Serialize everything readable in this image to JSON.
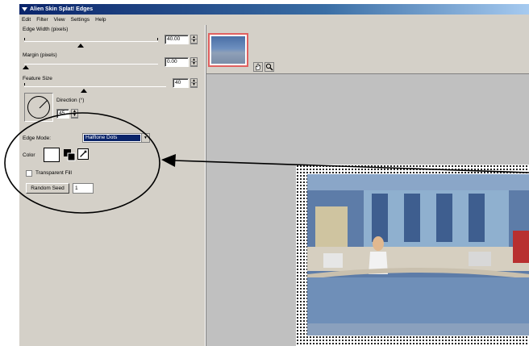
{
  "window": {
    "title": "Alien Skin Splat! Edges"
  },
  "menu": [
    "Edit",
    "Filter",
    "View",
    "Settings",
    "Help"
  ],
  "controls": {
    "edge_width": {
      "label": "Edge Width (pixels)",
      "value": "40.00"
    },
    "margin": {
      "label": "Margin (pixels)",
      "value": "0.00"
    },
    "feature_size": {
      "label": "Feature Size",
      "value": "40"
    },
    "direction": {
      "label": "Direction (°)",
      "value": "45"
    },
    "edge_mode": {
      "label": "Edge Mode:",
      "value": "Halftone Dots"
    },
    "color": {
      "label": "Color"
    },
    "transparent_fill": {
      "label": "Transparent Fill",
      "checked": false
    },
    "random_seed": {
      "button": "Random Seed",
      "value": "1"
    }
  },
  "toolbar": {
    "icons": [
      "hand-icon",
      "zoom-icon"
    ]
  },
  "annotation": {
    "shape": "ellipse",
    "arrow": "pointing-left",
    "color": "#000000"
  },
  "colors": {
    "titlebar": "#0a246a",
    "panel": "#d4d0c8",
    "selection": "#0a246a",
    "thumb_border": "#e06060"
  }
}
